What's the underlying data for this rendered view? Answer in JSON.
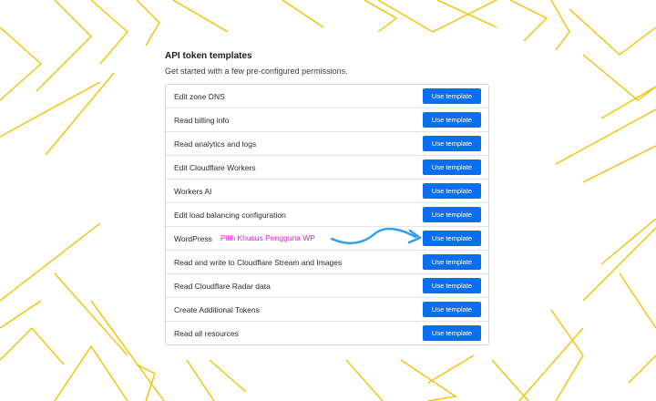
{
  "header": {
    "title": "API token templates",
    "subtitle": "Get started with a few pre-configured permissions."
  },
  "templates": [
    {
      "label": "Edit zone DNS",
      "button": "Use template"
    },
    {
      "label": "Read billing info",
      "button": "Use template"
    },
    {
      "label": "Read analytics and logs",
      "button": "Use template"
    },
    {
      "label": "Edit Cloudflare Workers",
      "button": "Use template"
    },
    {
      "label": "Workers AI",
      "button": "Use template"
    },
    {
      "label": "Edit load balancing configuration",
      "button": "Use template"
    },
    {
      "label": "WordPress",
      "button": "Use template"
    },
    {
      "label": "Read and write to Cloudflare Stream and Images",
      "button": "Use template"
    },
    {
      "label": "Read Cloudflare Radar data",
      "button": "Use template"
    },
    {
      "label": "Create Additional Tokens",
      "button": "Use template"
    },
    {
      "label": "Read all resources",
      "button": "Use template"
    }
  ],
  "annotation": {
    "text": "Pilih Khusus Pengguna WP",
    "color": "#e81fd6",
    "arrow_color": "#2a9df4"
  },
  "colors": {
    "primary_button": "#0a6ef0",
    "decor_lines": "#f2c200"
  }
}
